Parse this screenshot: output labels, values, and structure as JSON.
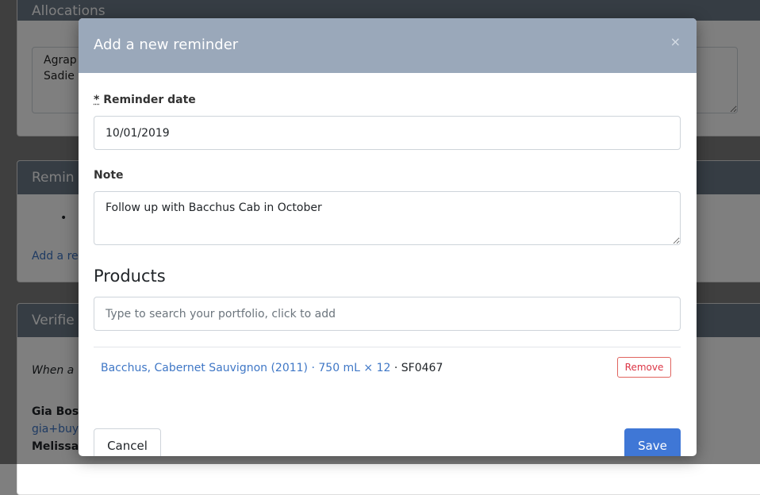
{
  "background": {
    "allocations": {
      "header": "Allocations",
      "textarea_line1": "Agrap",
      "textarea_line2": "Sadie"
    },
    "reminders": {
      "header": "Remin",
      "bullet": "•",
      "add_link": "Add a re"
    },
    "verified": {
      "header": "Verifie",
      "italic": "When a",
      "name1": "Gia Bos",
      "email1": "gia+buy",
      "name2": "Melissa"
    }
  },
  "modal": {
    "title": "Add a new reminder",
    "close_glyph": "×",
    "reminder_date": {
      "required_mark": "*",
      "label": "Reminder date",
      "value": "10/01/2019"
    },
    "note": {
      "label": "Note",
      "value": "Follow up with Bacchus Cab in October"
    },
    "products": {
      "title": "Products",
      "search_placeholder": "Type to search your portfolio, click to add",
      "items": [
        {
          "name": "Bacchus, Cabernet Sauvignon (2011) · 750 mL × 12",
          "sku": "SF0467",
          "remove_label": "Remove"
        }
      ]
    },
    "footer": {
      "cancel_label": "Cancel",
      "save_label": "Save"
    }
  },
  "colors": {
    "modal_header": "#9aa8ba",
    "card_header": "#6c7a89",
    "link": "#3f77c6",
    "primary": "#3f77d6",
    "danger": "#dc3545"
  }
}
